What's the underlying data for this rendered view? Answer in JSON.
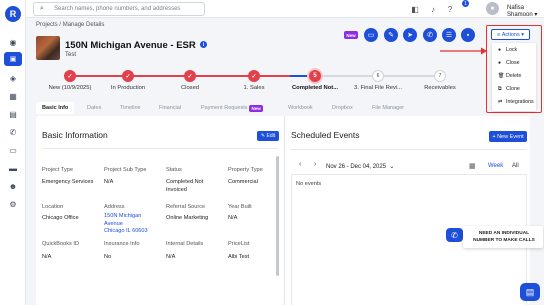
{
  "search": {
    "placeholder": "Search names, phone numbers, and addresses"
  },
  "topbar": {
    "notif_count": "1",
    "user_name": "Nafisa Shamoon",
    "user_caret": "▾"
  },
  "breadcrumb": {
    "parent": "Projects",
    "separator": "/",
    "current": "Manage Details"
  },
  "project": {
    "title": "150N Michigan Avenue - ESR",
    "subtitle": "Test"
  },
  "header_actions": {
    "new_badge": "New",
    "actions_label": "Actions",
    "actions_icon": "≡",
    "actions_caret": "▾"
  },
  "actions_menu": [
    {
      "icon": "●",
      "label": "Lock"
    },
    {
      "icon": "●",
      "label": "Close"
    },
    {
      "icon": "🗑",
      "label": "Delete"
    },
    {
      "icon": "⧉",
      "label": "Clone"
    },
    {
      "icon": "⇄",
      "label": "Integrations"
    }
  ],
  "stepper": {
    "steps": [
      {
        "mark": "✓",
        "label": "New (10/9/2025)",
        "state": "done"
      },
      {
        "mark": "✓",
        "label": "In Production",
        "state": "done"
      },
      {
        "mark": "✓",
        "label": "Closed",
        "state": "done"
      },
      {
        "mark": "✓",
        "label": "1. Sales",
        "state": "done"
      },
      {
        "mark": "5",
        "label": "Completed Not...",
        "state": "current"
      },
      {
        "mark": "6",
        "label": "3. Final File Revi...",
        "state": "todo"
      },
      {
        "mark": "7",
        "label": "Receivables",
        "state": "todo"
      }
    ]
  },
  "tabs": [
    {
      "label": "Basic Info"
    },
    {
      "label": "Dates"
    },
    {
      "label": "Timeline"
    },
    {
      "label": "Financial"
    },
    {
      "label": "Payment Requests",
      "badge": "New"
    },
    {
      "label": "Workbook"
    },
    {
      "label": "Dropbox"
    },
    {
      "label": "File Manager"
    }
  ],
  "basic_info": {
    "title": "Basic Information",
    "edit_label": "Edit",
    "fields": {
      "project_type": {
        "label": "Project Type",
        "value": "Emergency Services"
      },
      "project_sub_type": {
        "label": "Project Sub Type",
        "value": "N/A"
      },
      "status": {
        "label": "Status",
        "value": "Completed Not Invoiced"
      },
      "property_type": {
        "label": "Property Type",
        "value": "Commercial"
      },
      "location": {
        "label": "Location",
        "value": "Chicago Office"
      },
      "address": {
        "label": "Address",
        "value_line1": "150N Michigan",
        "value_line2": "Avenue",
        "value_line3": "Chicago IL 60603"
      },
      "referral_source": {
        "label": "Referral Source",
        "value": "Online Marketing"
      },
      "year_built": {
        "label": "Year Built",
        "value": "N/A"
      },
      "quickbooks_id": {
        "label": "QuickBooks ID",
        "value": "N/A"
      },
      "insurance_info": {
        "label": "Insurance Info",
        "value": "No"
      },
      "internal_details": {
        "label": "Internal Details",
        "value": "N/A"
      },
      "pricelist": {
        "label": "PriceList",
        "value": "Albi Test"
      }
    }
  },
  "scheduled_events": {
    "title": "Scheduled Events",
    "new_event_label": "+ New Event",
    "date_range": "Nov 26 - Dec 04, 2025",
    "view_week": "Week",
    "view_all": "All",
    "empty_text": "No events"
  },
  "call_banner": {
    "text": "NEED AN INDIVIDUAL NUMBER TO MAKE CALLS"
  },
  "colors": {
    "primary": "#1e4fd8",
    "step_done": "#e2404a",
    "new_badge": "#8e2de2",
    "highlight_box": "#e5322d"
  }
}
